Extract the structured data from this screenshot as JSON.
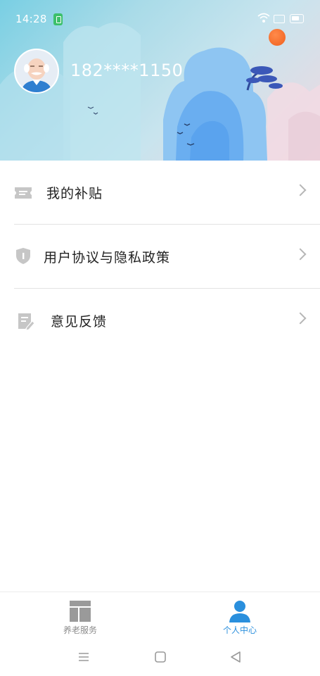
{
  "status_bar": {
    "time": "14:28"
  },
  "profile": {
    "phone": "182****1150"
  },
  "menu": {
    "items": [
      {
        "label": "我的补贴",
        "icon": "ticket-icon"
      },
      {
        "label": "用户协议与隐私政策",
        "icon": "shield-icon"
      },
      {
        "label": "意见反馈",
        "icon": "feedback-edit-icon"
      }
    ]
  },
  "bottom_nav": {
    "tabs": [
      {
        "label": "养老服务",
        "icon": "dashboard-layout-icon",
        "active": false
      },
      {
        "label": "个人中心",
        "icon": "person-icon",
        "active": true
      }
    ]
  },
  "colors": {
    "accent": "#2a8fdd",
    "inactive": "#8c8c8c",
    "header_gradient_start": "#79cfe3",
    "header_gradient_end": "#f0d8df"
  }
}
